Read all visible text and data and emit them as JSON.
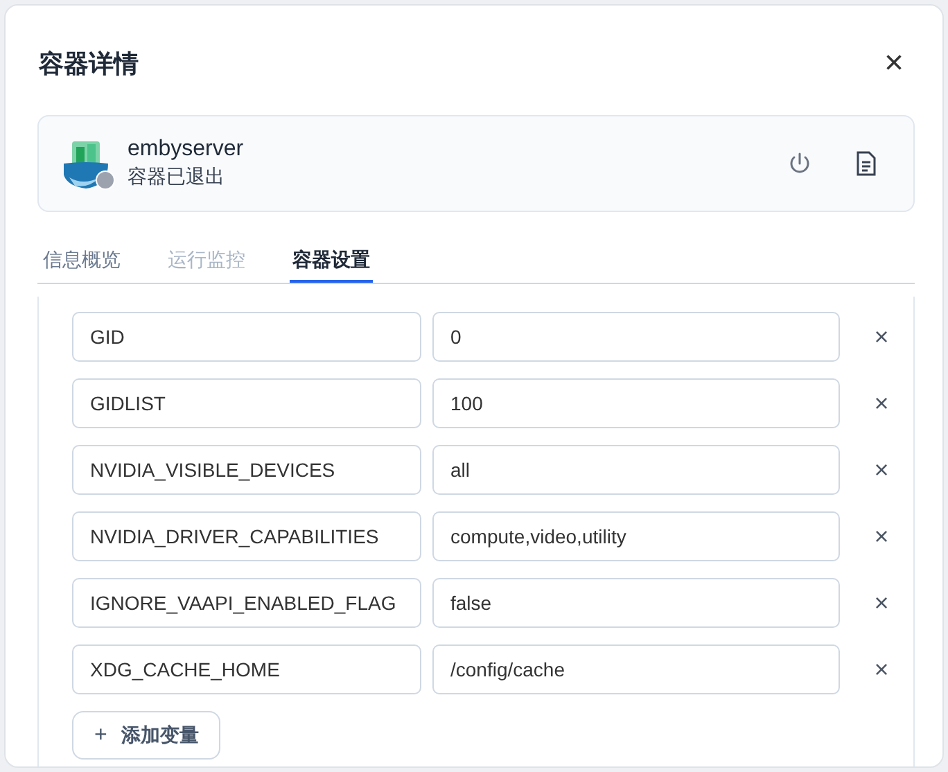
{
  "dialog": {
    "title": "容器详情",
    "close_icon": "×"
  },
  "container": {
    "name": "embyserver",
    "status": "容器已退出",
    "running": false
  },
  "tabs": [
    {
      "label": "信息概览",
      "selected": false,
      "disabled": false
    },
    {
      "label": "运行监控",
      "selected": false,
      "disabled": true
    },
    {
      "label": "容器设置",
      "selected": true,
      "disabled": false
    }
  ],
  "env_vars": [
    {
      "key": "GID",
      "value": "0"
    },
    {
      "key": "GIDLIST",
      "value": "100"
    },
    {
      "key": "NVIDIA_VISIBLE_DEVICES",
      "value": "all"
    },
    {
      "key": "NVIDIA_DRIVER_CAPABILITIES",
      "value": "compute,video,utility"
    },
    {
      "key": "IGNORE_VAAPI_ENABLED_FLAG",
      "value": "false"
    },
    {
      "key": "XDG_CACHE_HOME",
      "value": "/config/cache"
    }
  ],
  "remove_icon": "×",
  "add_button": {
    "icon": "+",
    "label": "添加变量"
  }
}
